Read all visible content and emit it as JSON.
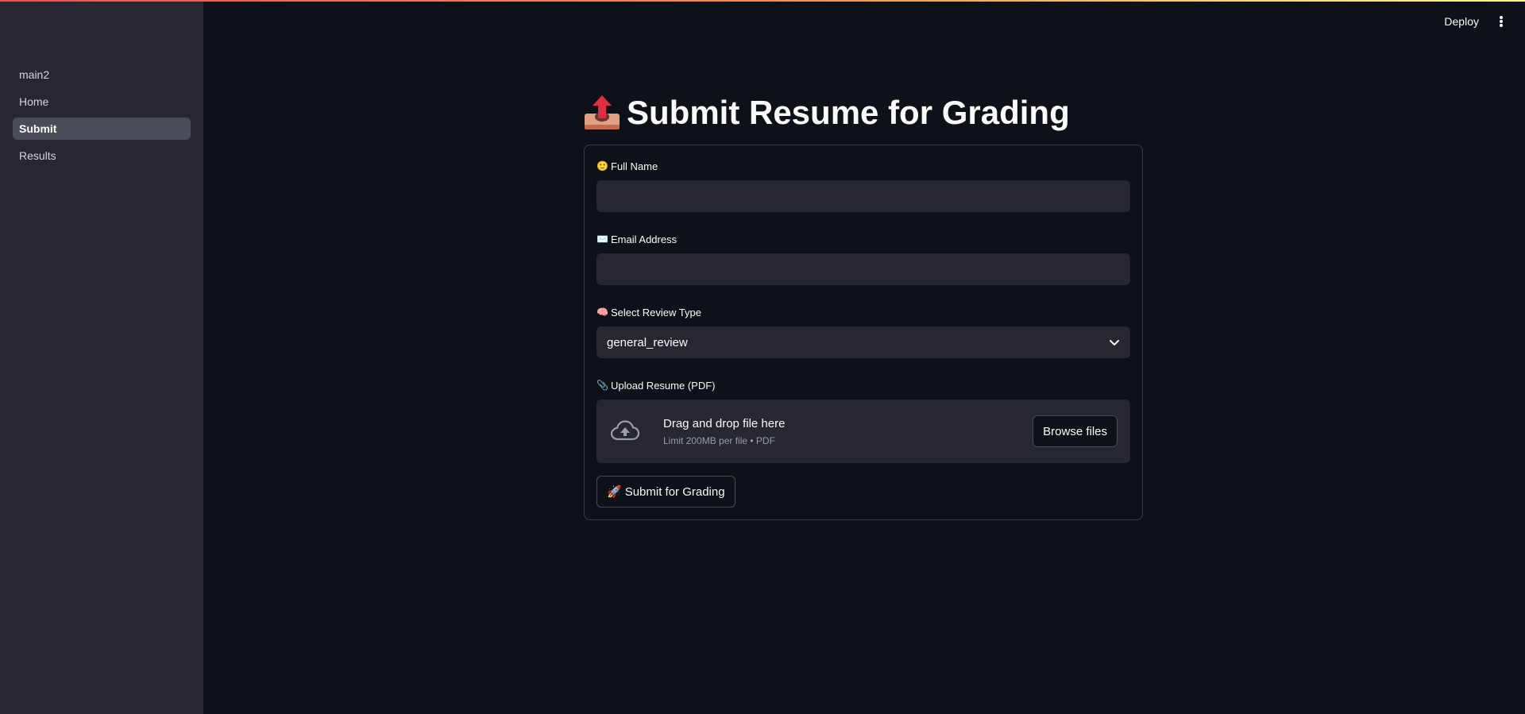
{
  "sidebar": {
    "items": [
      {
        "label": "main2",
        "active": false
      },
      {
        "label": "Home",
        "active": false
      },
      {
        "label": "Submit",
        "active": true
      },
      {
        "label": "Results",
        "active": false
      }
    ]
  },
  "header": {
    "deploy_label": "Deploy",
    "menu_icon": "kebab-menu-icon"
  },
  "page": {
    "title_icon": "outbox-tray-icon",
    "title": "Submit Resume for Grading"
  },
  "form": {
    "full_name": {
      "emoji": "🙂",
      "label": "Full Name",
      "value": "",
      "placeholder": ""
    },
    "email": {
      "emoji": "✉️",
      "label": "Email Address",
      "value": "",
      "placeholder": ""
    },
    "review_type": {
      "emoji": "🧠",
      "label": "Select Review Type",
      "selected": "general_review"
    },
    "upload": {
      "emoji": "📎",
      "label": "Upload Resume (PDF)",
      "drop_text": "Drag and drop file here",
      "limit_text": "Limit 200MB per file • PDF",
      "browse_label": "Browse files"
    },
    "submit": {
      "emoji": "🚀",
      "label": "Submit for Grading"
    }
  },
  "colors": {
    "background": "#0e1117",
    "sidebar": "#262730",
    "accent_red": "#ff4b4b",
    "input_bg": "#262730"
  }
}
